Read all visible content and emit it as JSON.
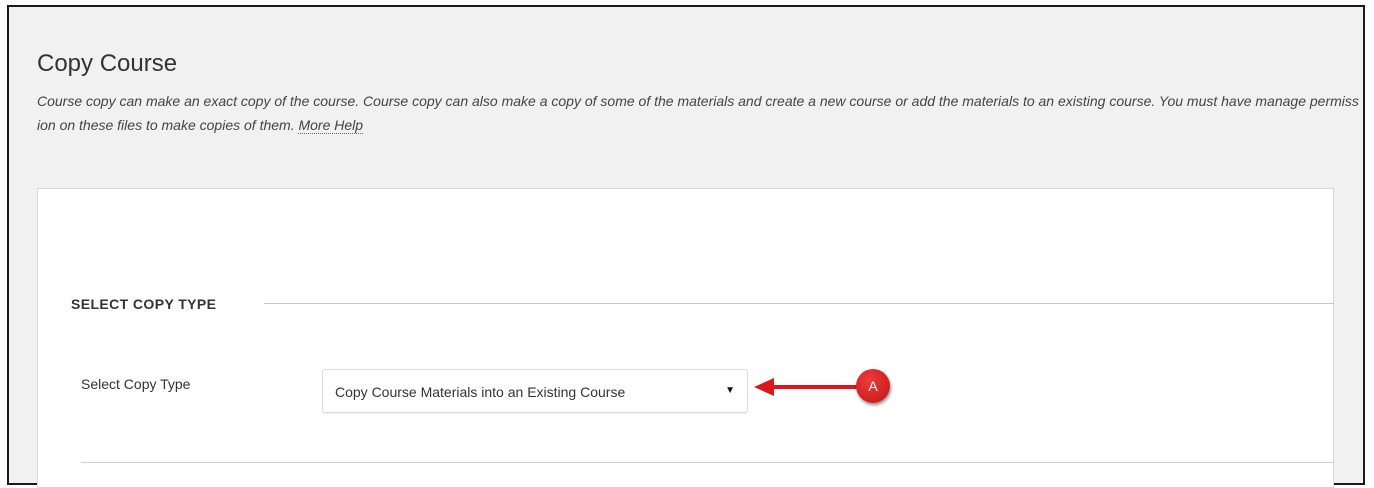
{
  "page": {
    "title": "Copy Course",
    "description": "Course copy can make an exact copy of the course. Course copy can also make a copy of some of the materials and create a new course or add the materials to an existing course. You must have manage permission on these files to make copies of them.",
    "help_link": "More Help"
  },
  "section": {
    "heading": "SELECT COPY TYPE"
  },
  "copy_type": {
    "label": "Select Copy Type",
    "selected_value": "Copy Course Materials into an Existing Course",
    "caret_icon": "caret-down-icon"
  },
  "annotation": {
    "marker_label": "A",
    "color": "#d7191c"
  }
}
